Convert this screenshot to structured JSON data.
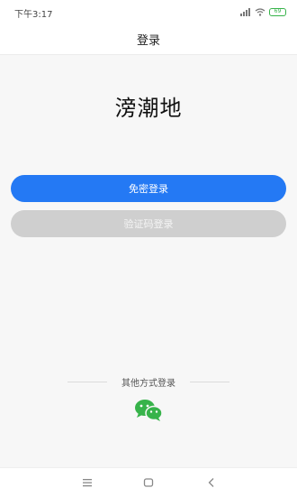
{
  "status_bar": {
    "time": "下午3:17",
    "battery_level": "69",
    "icons": [
      "signal-icon",
      "wifi-icon",
      "battery-icon"
    ]
  },
  "header": {
    "title": "登录"
  },
  "app": {
    "name": "滂潮地"
  },
  "buttons": {
    "passwordless_login": "免密登录",
    "code_login": "验证码登录"
  },
  "other_login": {
    "label": "其他方式登录",
    "providers": [
      "wechat-icon"
    ]
  },
  "colors": {
    "primary": "#2479f4",
    "disabled": "#cfcfcf",
    "wechat": "#37b34a"
  },
  "system_nav": {
    "icons": [
      "menu-icon",
      "home-icon",
      "back-icon"
    ]
  }
}
